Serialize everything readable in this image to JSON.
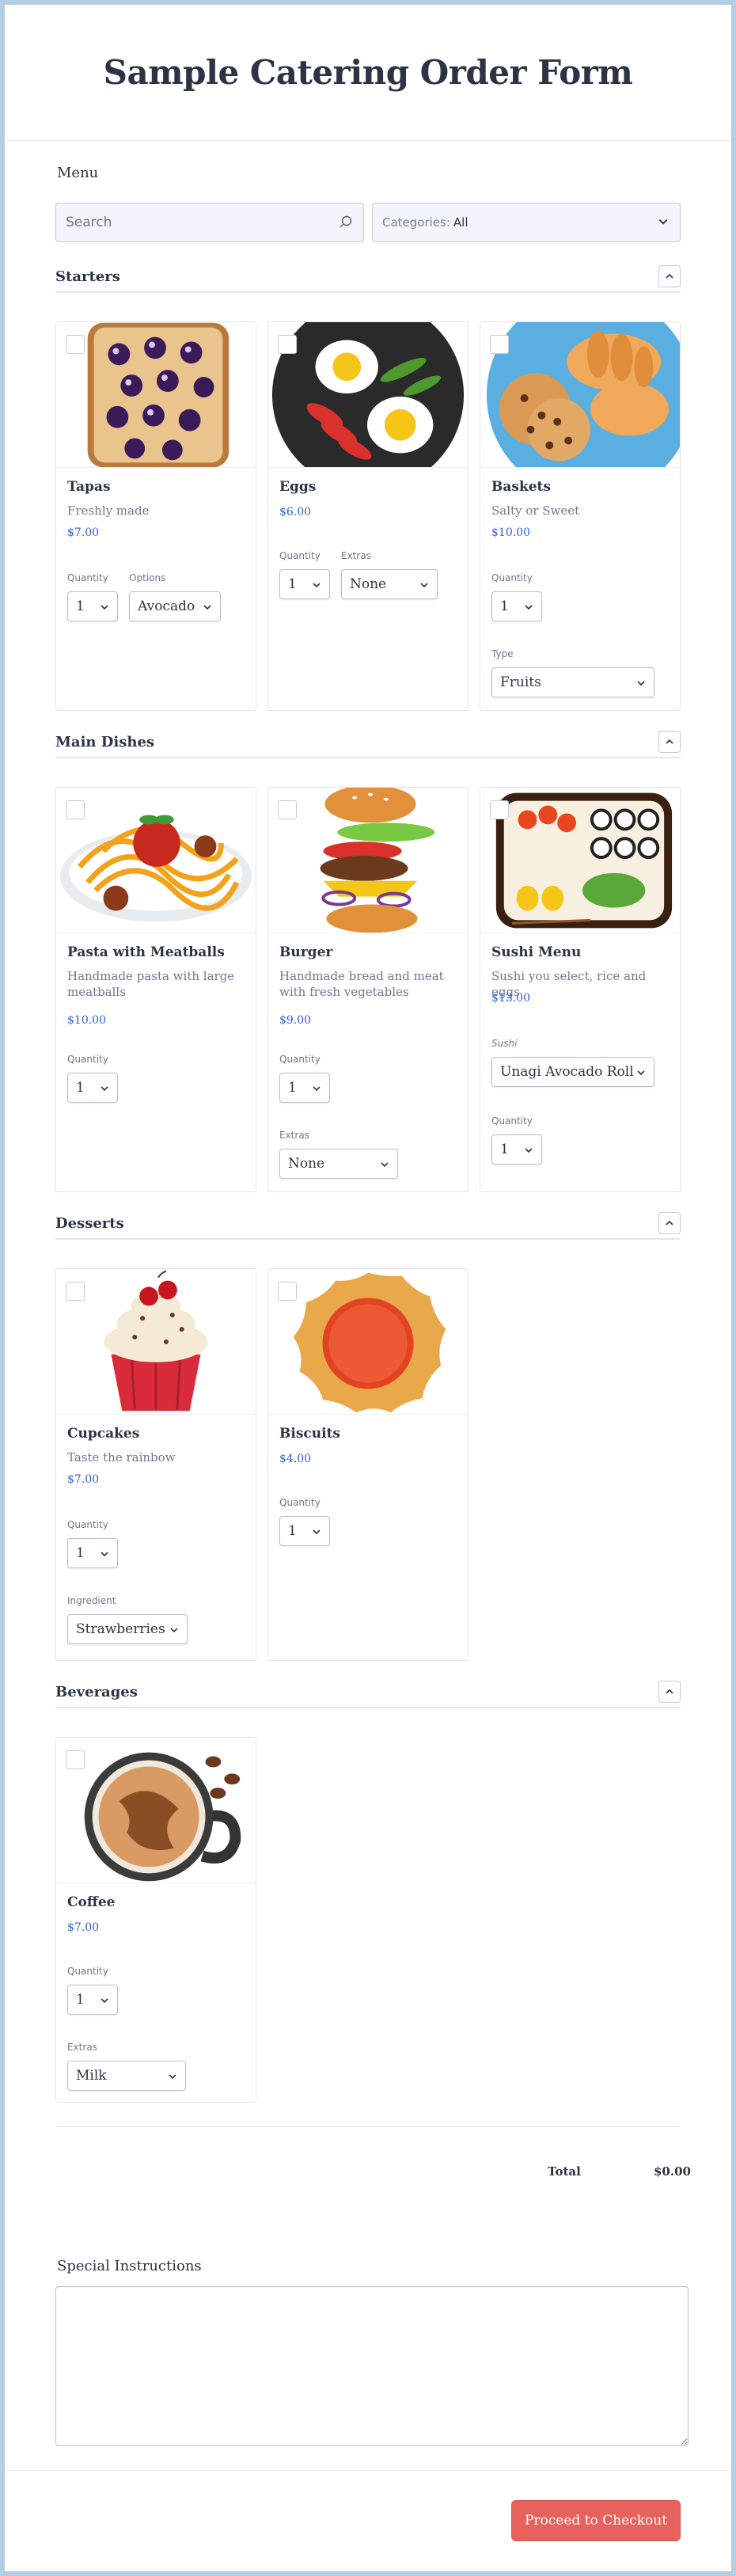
{
  "title": "Sample Catering Order Form",
  "menu_label": "Menu",
  "search": {
    "placeholder": "Search"
  },
  "categories": {
    "label": "Categories:",
    "value": "All"
  },
  "sections": {
    "starters": {
      "title": "Starters",
      "items": [
        {
          "name": "Tapas",
          "desc": "Freshly made",
          "price": "$7.00",
          "qty_label": "Quantity",
          "qty": "1",
          "opt_label": "Options",
          "opt": "Avocado"
        },
        {
          "name": "Eggs",
          "price": "$6.00",
          "qty_label": "Quantity",
          "qty": "1",
          "opt_label": "Extras",
          "opt": "None"
        },
        {
          "name": "Baskets",
          "desc": "Salty or Sweet",
          "price": "$10.00",
          "qty_label": "Quantity",
          "qty": "1",
          "opt_label": "Type",
          "opt": "Fruits"
        }
      ]
    },
    "main": {
      "title": "Main Dishes",
      "items": [
        {
          "name": "Pasta with Meatballs",
          "desc": "Handmade pasta with large meatballs",
          "price": "$10.00",
          "qty_label": "Quantity",
          "qty": "1"
        },
        {
          "name": "Burger",
          "desc": "Handmade bread and meat with fresh vegetables",
          "price": "$9.00",
          "qty_label": "Quantity",
          "qty": "1",
          "opt_label": "Extras",
          "opt": "None"
        },
        {
          "name": "Sushi Menu",
          "desc": "Sushi you select, rice and eggs",
          "price": "$13.00",
          "opt_label": "Sushi",
          "opt": "Unagi Avocado Roll",
          "qty_label": "Quantity",
          "qty": "1"
        }
      ]
    },
    "desserts": {
      "title": "Desserts",
      "items": [
        {
          "name": "Cupcakes",
          "desc": "Taste the rainbow",
          "price": "$7.00",
          "qty_label": "Quantity",
          "qty": "1",
          "opt_label": "Ingredient",
          "opt": "Strawberries"
        },
        {
          "name": "Biscuits",
          "price": "$4.00",
          "qty_label": "Quantity",
          "qty": "1"
        }
      ]
    },
    "beverages": {
      "title": "Beverages",
      "items": [
        {
          "name": "Coffee",
          "price": "$7.00",
          "qty_label": "Quantity",
          "qty": "1",
          "opt_label": "Extras",
          "opt": "Milk"
        }
      ]
    }
  },
  "total": {
    "label": "Total",
    "value": "$0.00"
  },
  "special": {
    "label": "Special Instructions"
  },
  "checkout": {
    "label": "Proceed to Checkout"
  },
  "colors": {
    "accent": "#2b5fd9",
    "button": "#e8625d",
    "border": "#b4cfe3"
  }
}
